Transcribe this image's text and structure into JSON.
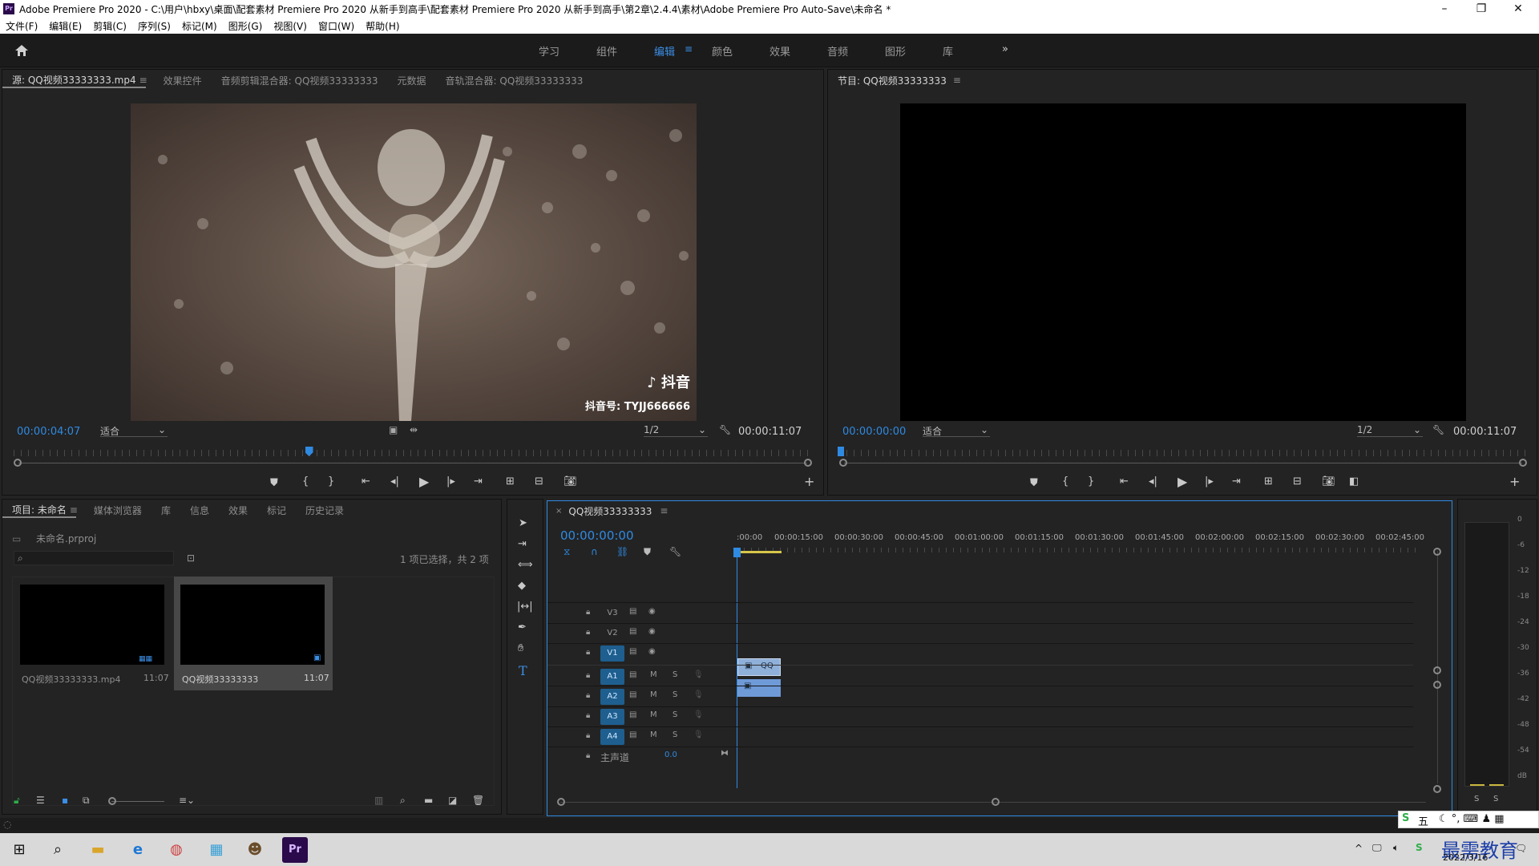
{
  "window": {
    "title": "Adobe Premiere Pro 2020 - C:\\用户\\hbxy\\桌面\\配套素材 Premiere Pro 2020 从新手到高手\\配套素材 Premiere Pro 2020 从新手到高手\\第2章\\2.4.4\\素材\\Adobe Premiere Pro Auto-Save\\未命名 *",
    "app_icon": "Pr",
    "controls": {
      "minimize": "–",
      "restore": "❐",
      "close": "✕"
    }
  },
  "menu": [
    "文件(F)",
    "编辑(E)",
    "剪辑(C)",
    "序列(S)",
    "标记(M)",
    "图形(G)",
    "视图(V)",
    "窗口(W)",
    "帮助(H)"
  ],
  "workspaces": {
    "items": [
      "学习",
      "组件",
      "编辑",
      "颜色",
      "效果",
      "音频",
      "图形",
      "库"
    ],
    "active": "编辑",
    "more": "»"
  },
  "source": {
    "tabs": [
      "源: QQ视频33333333.mp4",
      "效果控件",
      "音频剪辑混合器: QQ视频33333333",
      "元数据",
      "音轨混合器: QQ视频33333333"
    ],
    "timecode": "00:00:04:07",
    "fit": "适合",
    "resolution": "1/2",
    "duration": "00:00:11:07",
    "watermark_logo": "抖音",
    "watermark_id": "抖音号: TYJJ666666",
    "playhead_fraction": 0.37
  },
  "program": {
    "tab": "节目: QQ视频33333333",
    "timecode": "00:00:00:00",
    "fit": "适合",
    "resolution": "1/2",
    "duration": "00:00:11:07"
  },
  "project": {
    "tabs": [
      "项目: 未命名",
      "媒体浏览器",
      "库",
      "信息",
      "效果",
      "标记",
      "历史记录"
    ],
    "file": "未命名.prproj",
    "selection_info": "1 项已选择，共 2 项",
    "items": [
      {
        "name": "QQ视频33333333.mp4",
        "duration": "11:07"
      },
      {
        "name": "QQ视频33333333",
        "duration": "11:07"
      }
    ]
  },
  "timeline": {
    "tab": "QQ视频33333333",
    "timecode": "00:00:00:00",
    "ruler": [
      ":00:00",
      "00:00:15:00",
      "00:00:30:00",
      "00:00:45:00",
      "00:01:00:00",
      "00:01:15:00",
      "00:01:30:00",
      "00:01:45:00",
      "00:02:00:00",
      "00:02:15:00",
      "00:02:30:00",
      "00:02:45:00"
    ],
    "video_tracks": [
      "V3",
      "V2",
      "V1"
    ],
    "audio_tracks": [
      "A1",
      "A2",
      "A3",
      "A4"
    ],
    "mute_label": "M",
    "solo_label": "S",
    "master_label": "主声道",
    "master_value": "0.0",
    "clip_label": "QQ"
  },
  "meter": {
    "scale": [
      "0",
      "-6",
      "-12",
      "-18",
      "-24",
      "-30",
      "-36",
      "-42",
      "-48",
      "-54",
      "dB"
    ],
    "solo": [
      "S",
      "S"
    ]
  },
  "taskbar": {
    "date": "2022/3/16",
    "watermark": "最需教育",
    "ime": "五"
  }
}
